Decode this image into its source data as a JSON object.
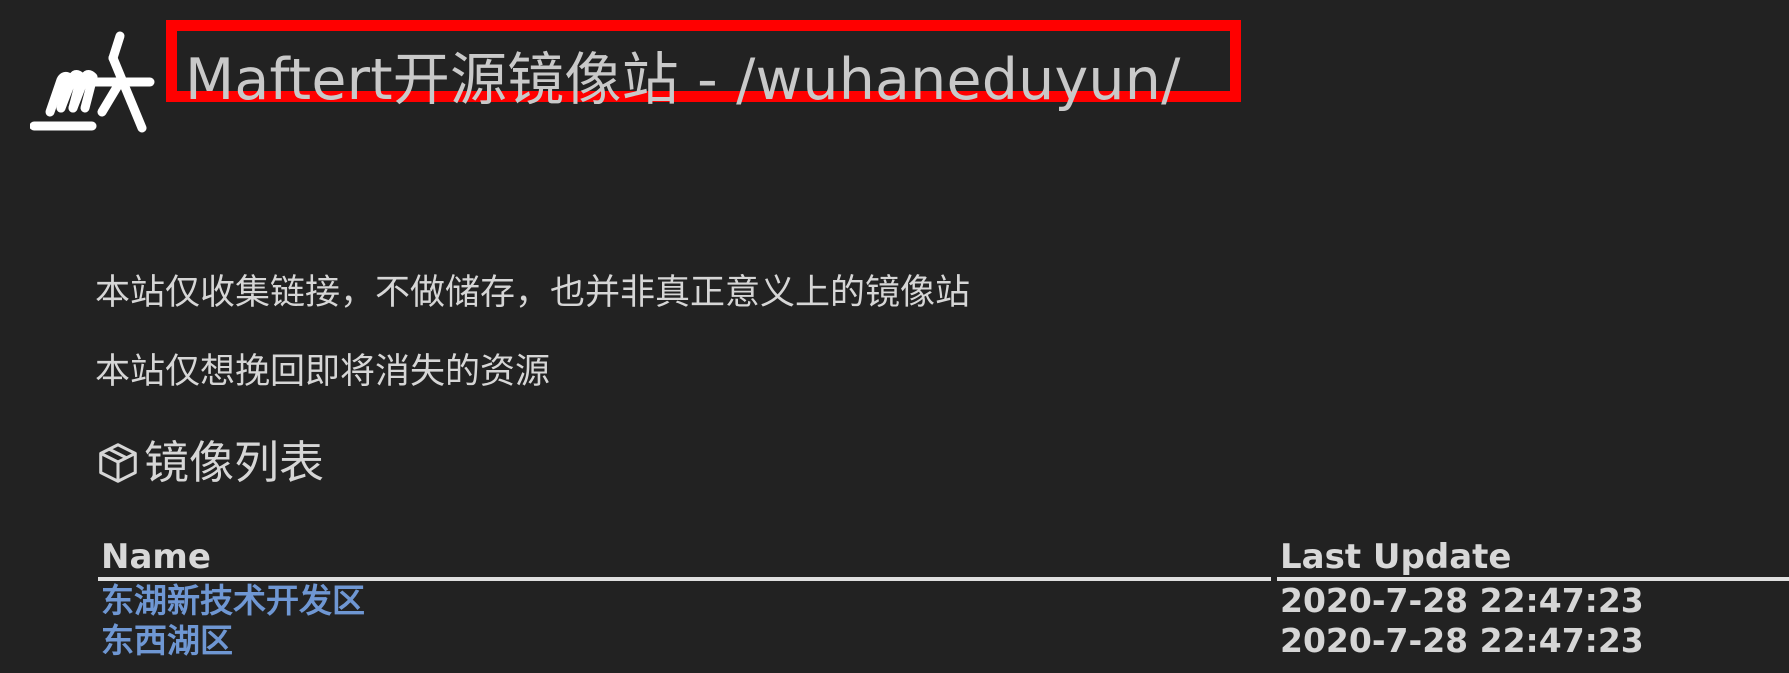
{
  "header": {
    "title": "Maftert开源镜像站 - /wuhaneduyun/"
  },
  "notices": [
    "本站仅收集链接，不做储存，也并非真正意义上的镜像站",
    "本站仅想挽回即将消失的资源"
  ],
  "section": {
    "icon": "cube-icon",
    "title": "镜像列表"
  },
  "table": {
    "columns": {
      "name": "Name",
      "last_update": "Last Update"
    },
    "rows": [
      {
        "name": "东湖新技术开发区",
        "last_update": "2020-7-28 22:47:23"
      },
      {
        "name": "东西湖区",
        "last_update": "2020-7-28 22:47:23"
      }
    ]
  },
  "colors": {
    "background": "#222222",
    "highlight_frame": "#ff0000",
    "link": "#6f97d3",
    "text": "#d6d6d6"
  }
}
